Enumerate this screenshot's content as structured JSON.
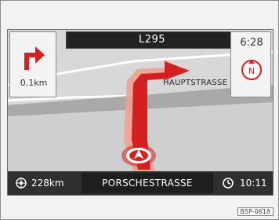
{
  "route": {
    "road_number": "L295",
    "next_street": "HAUPTSTRASSE",
    "current_street": "PORSCHESTRASSE"
  },
  "turn": {
    "icon": "turn-right-arrow-icon",
    "distance": "0.1km"
  },
  "clock": {
    "time": "6:28",
    "compass_icon": "north-compass-icon",
    "compass_letter": "N"
  },
  "status": {
    "remaining_distance": "228km",
    "remaining_icon": "destination-flag-icon",
    "eta_time": "10:11",
    "eta_icon": "clock-icon"
  },
  "figure_code": "B5P-0618",
  "colors": {
    "route_red": "#d42020",
    "route_light": "#f0a090",
    "bar": "#2f2f2f",
    "map_bg": "#cfcfcf"
  }
}
